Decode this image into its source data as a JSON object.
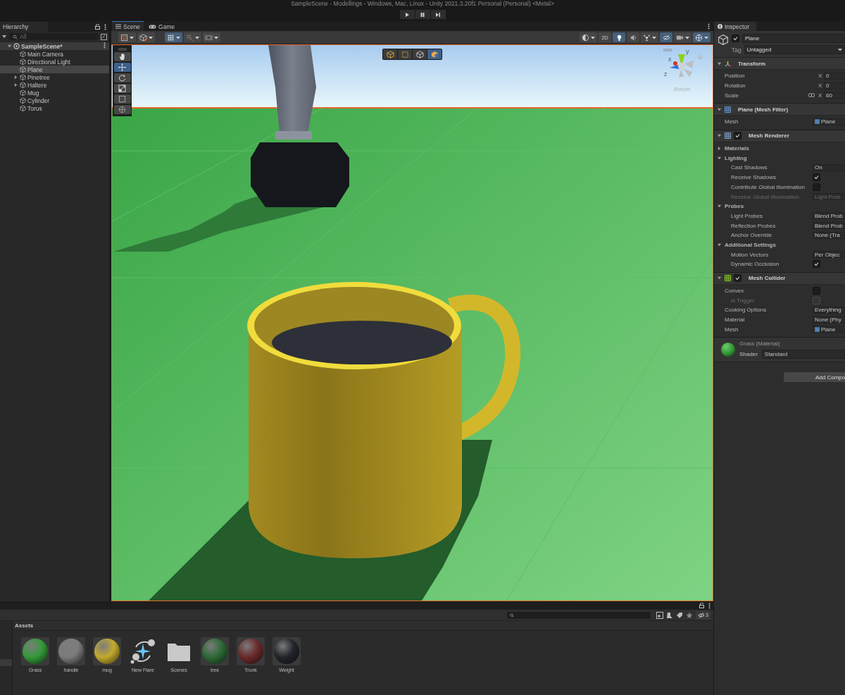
{
  "window": {
    "title": "SampleScene - Modellings - Windows, Mac, Linux - Unity 2021.3.20f1 Personal (Personal) <Metal>"
  },
  "playbar": [
    {
      "kind": "play"
    },
    {
      "kind": "pause"
    },
    {
      "kind": "step"
    }
  ],
  "hierarchy": {
    "tab": "Hierarchy",
    "search": {
      "placeholder": "All"
    },
    "scene": {
      "label": "SampleScene*",
      "expanded": true
    },
    "items": [
      {
        "label": "Main Camera",
        "selected": false,
        "expandable": false
      },
      {
        "label": "Directional Light",
        "selected": false,
        "expandable": false
      },
      {
        "label": "Plane",
        "selected": true,
        "expandable": false
      },
      {
        "label": "Pinetree",
        "selected": false,
        "expandable": true
      },
      {
        "label": "Haltere",
        "selected": false,
        "expandable": true
      },
      {
        "label": "Mug",
        "selected": false,
        "expandable": false
      },
      {
        "label": "Cylinder",
        "selected": false,
        "expandable": false
      },
      {
        "label": "Torus",
        "selected": false,
        "expandable": false
      }
    ]
  },
  "scene_view": {
    "tabs": [
      {
        "label": "Scene",
        "kind": "scene",
        "selected": true
      },
      {
        "label": "Game",
        "kind": "game",
        "selected": false
      }
    ],
    "toolbar_left": [
      {
        "kind": "draw-mode",
        "on": false,
        "dropdown": true
      },
      {
        "kind": "cube",
        "on": false,
        "dropdown": true
      },
      {
        "kind": "grid",
        "on": true,
        "dropdown": true
      },
      {
        "kind": "snap",
        "on": false,
        "dropdown": true
      },
      {
        "kind": "increment",
        "on": false,
        "dropdown": true
      }
    ],
    "toolbar_right": [
      {
        "kind": "sphere",
        "on": false,
        "dropdown": true
      },
      {
        "kind": "label",
        "label": "2D",
        "on": false,
        "dropdown": false
      },
      {
        "kind": "light",
        "on": true,
        "dropdown": false
      },
      {
        "kind": "audio",
        "on": false,
        "dropdown": false
      },
      {
        "kind": "effects",
        "on": false,
        "dropdown": true
      },
      {
        "kind": "hidden",
        "on": true,
        "dropdown": false
      },
      {
        "kind": "camera",
        "on": false,
        "dropdown": true
      },
      {
        "kind": "gizmos",
        "on": true,
        "dropdown": true
      }
    ],
    "tools": [
      {
        "kind": "hand",
        "selected": false
      },
      {
        "kind": "move",
        "selected": true
      },
      {
        "kind": "rotate",
        "selected": false
      },
      {
        "kind": "scale",
        "selected": false
      },
      {
        "kind": "rect",
        "selected": false
      },
      {
        "kind": "transform",
        "selected": false
      }
    ],
    "view_modes": [
      {
        "kind": "cube",
        "selected": false
      },
      {
        "kind": "rect",
        "selected": false
      },
      {
        "kind": "cube-outline",
        "selected": false
      },
      {
        "kind": "cube-solid",
        "selected": true
      }
    ],
    "gizmo": {
      "label": "Bottom",
      "axes": [
        {
          "label": "y",
          "color": "#8fd11f"
        },
        {
          "label": "x",
          "color": "#d0361f"
        },
        {
          "label": "z",
          "color": "#2e6ee0"
        }
      ]
    }
  },
  "inspector": {
    "tab": "Inspector",
    "object": {
      "active": true,
      "name": "Plane",
      "tag_label": "Tag",
      "tag": "Untagged"
    },
    "components": [
      {
        "kind": "transform",
        "title": "Transform",
        "expanded": true,
        "rows": [
          {
            "kind": "vector",
            "label": "Position",
            "axis": "X",
            "value": "0",
            "constrained": false
          },
          {
            "kind": "vector",
            "label": "Rotation",
            "axis": "X",
            "value": "0",
            "constrained": false
          },
          {
            "kind": "vector",
            "label": "Scale",
            "axis": "X",
            "value": "60",
            "constrained": true
          }
        ]
      },
      {
        "kind": "mesh-filter",
        "title": "Plane (Mesh Filter)",
        "expanded": true,
        "rows": [
          {
            "kind": "asset",
            "label": "Mesh",
            "value": "Plane",
            "disabled": false
          }
        ]
      },
      {
        "kind": "mesh-renderer",
        "title": "Mesh Renderer",
        "enabled": true,
        "expanded": true,
        "rows": [
          {
            "kind": "group",
            "label": "Materials",
            "expanded": false
          },
          {
            "kind": "group",
            "label": "Lighting",
            "expanded": true,
            "children": [
              {
                "kind": "field",
                "label": "Cast Shadows",
                "value": "On",
                "disabled": false
              },
              {
                "kind": "check",
                "label": "Receive Shadows",
                "checked": true,
                "disabled": false
              },
              {
                "kind": "check",
                "label": "Contribute Global Illumination",
                "checked": false,
                "disabled": false
              },
              {
                "kind": "field",
                "label": "Receive Global Illumination",
                "value": "Light Prob",
                "disabled": true
              }
            ]
          },
          {
            "kind": "group",
            "label": "Probes",
            "expanded": true,
            "children": [
              {
                "kind": "field",
                "label": "Light Probes",
                "value": "Blend Prob",
                "disabled": false
              },
              {
                "kind": "field",
                "label": "Reflection Probes",
                "value": "Blend Prob",
                "disabled": false
              },
              {
                "kind": "field",
                "label": "Anchor Override",
                "value": "None (Tra",
                "disabled": false
              }
            ]
          },
          {
            "kind": "group",
            "label": "Additional Settings",
            "expanded": true,
            "children": [
              {
                "kind": "field",
                "label": "Motion Vectors",
                "value": "Per Objec",
                "disabled": false
              },
              {
                "kind": "check",
                "label": "Dynamic Occlusion",
                "checked": true,
                "disabled": false
              }
            ]
          }
        ]
      },
      {
        "kind": "mesh-collider",
        "title": "Mesh Collider",
        "enabled": true,
        "expanded": true,
        "rows": [
          {
            "kind": "check",
            "label": "Convex",
            "checked": false,
            "disabled": false,
            "children": [
              {
                "kind": "check",
                "label": "Is Trigger",
                "checked": false,
                "disabled": true
              }
            ]
          },
          {
            "kind": "field",
            "label": "Cooking Options",
            "value": "Everything",
            "disabled": false
          },
          {
            "kind": "field",
            "label": "Material",
            "value": "None (Phy",
            "disabled": false
          },
          {
            "kind": "asset",
            "label": "Mesh",
            "value": "Plane",
            "disabled": false
          }
        ]
      }
    ],
    "material": {
      "name": "Grass (Material)",
      "shader_label": "Shader",
      "shader": "Standard",
      "color": "#2f8f2f"
    },
    "add_button": "Add Compo"
  },
  "project": {
    "breadcrumb": "Assets",
    "filter_count": "3",
    "assets": [
      {
        "label": "Grass",
        "kind": "material",
        "color": "#349a3a"
      },
      {
        "label": "handle",
        "kind": "material",
        "color": "#7c7c7c"
      },
      {
        "label": "mug",
        "kind": "material",
        "color": "#c2aa2e"
      },
      {
        "label": "New Flare",
        "kind": "flare"
      },
      {
        "label": "Scenes",
        "kind": "folder"
      },
      {
        "label": "tree",
        "kind": "material",
        "color": "#2d6a36"
      },
      {
        "label": "Trunk",
        "kind": "material",
        "color": "#6a2a2a"
      },
      {
        "label": "Weight",
        "kind": "material",
        "color": "#22252b"
      }
    ]
  }
}
